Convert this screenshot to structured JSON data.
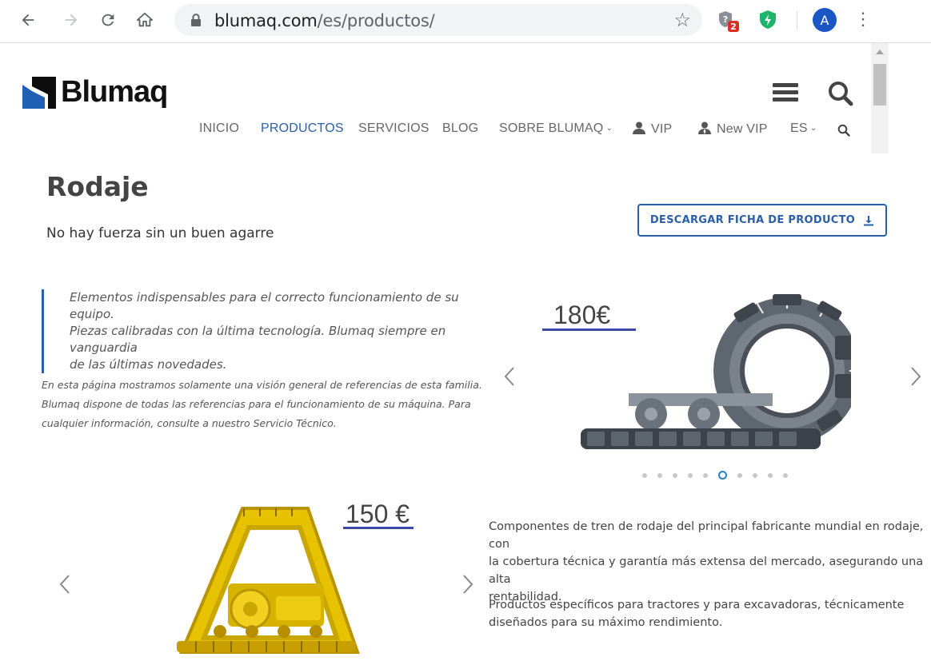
{
  "browser": {
    "url_host": "blumaq.com",
    "url_path": "/es/productos/",
    "ext_badge": "2",
    "avatar_initial": "A"
  },
  "site": {
    "logo_text": "Blumaq",
    "nav": [
      {
        "label": "INICIO"
      },
      {
        "label": "PRODUCTOS",
        "active": true
      },
      {
        "label": "SERVICIOS"
      },
      {
        "label": "BLOG"
      },
      {
        "label": "SOBRE BLUMAQ"
      },
      {
        "label": "VIP"
      },
      {
        "label": "New VIP"
      },
      {
        "label": "ES"
      }
    ]
  },
  "content": {
    "title": "Rodaje",
    "tagline": "No hay fuerza sin un buen agarre",
    "download_label": "DESCARGAR FICHA DE PRODUCTO",
    "quote": [
      "Elementos indispensables para el correcto funcionamiento de su equipo.",
      "Piezas calibradas con la última tecnología. Blumaq siempre en vanguardia",
      "de las últimas novedades."
    ],
    "note": [
      "En esta página mostramos solamente una visión general de referencias de esta familia.",
      "Blumaq dispone de todas las referencias para el funcionamiento de su máquina. Para",
      "cualquier información, consulte a nuestro Servicio Técnico."
    ],
    "carousel_top": {
      "price": "180€",
      "slide_count": 10,
      "active_index": 5
    },
    "carousel_bottom": {
      "price": "150 €"
    },
    "desc1": [
      "Componentes de tren de rodaje del principal fabricante mundial en rodaje, con",
      "la cobertura técnica y garantía más extensa del mercado, asegurando una alta",
      "rentabilidad."
    ],
    "desc2": [
      "Productos específicos para tractores y para excavadoras, técnicamente",
      "diseñados para su máximo rendimiento."
    ]
  },
  "colors": {
    "accent": "#2a5fa8",
    "price_underline": "#3d49a8",
    "dot_active": "#2a7fc2"
  }
}
